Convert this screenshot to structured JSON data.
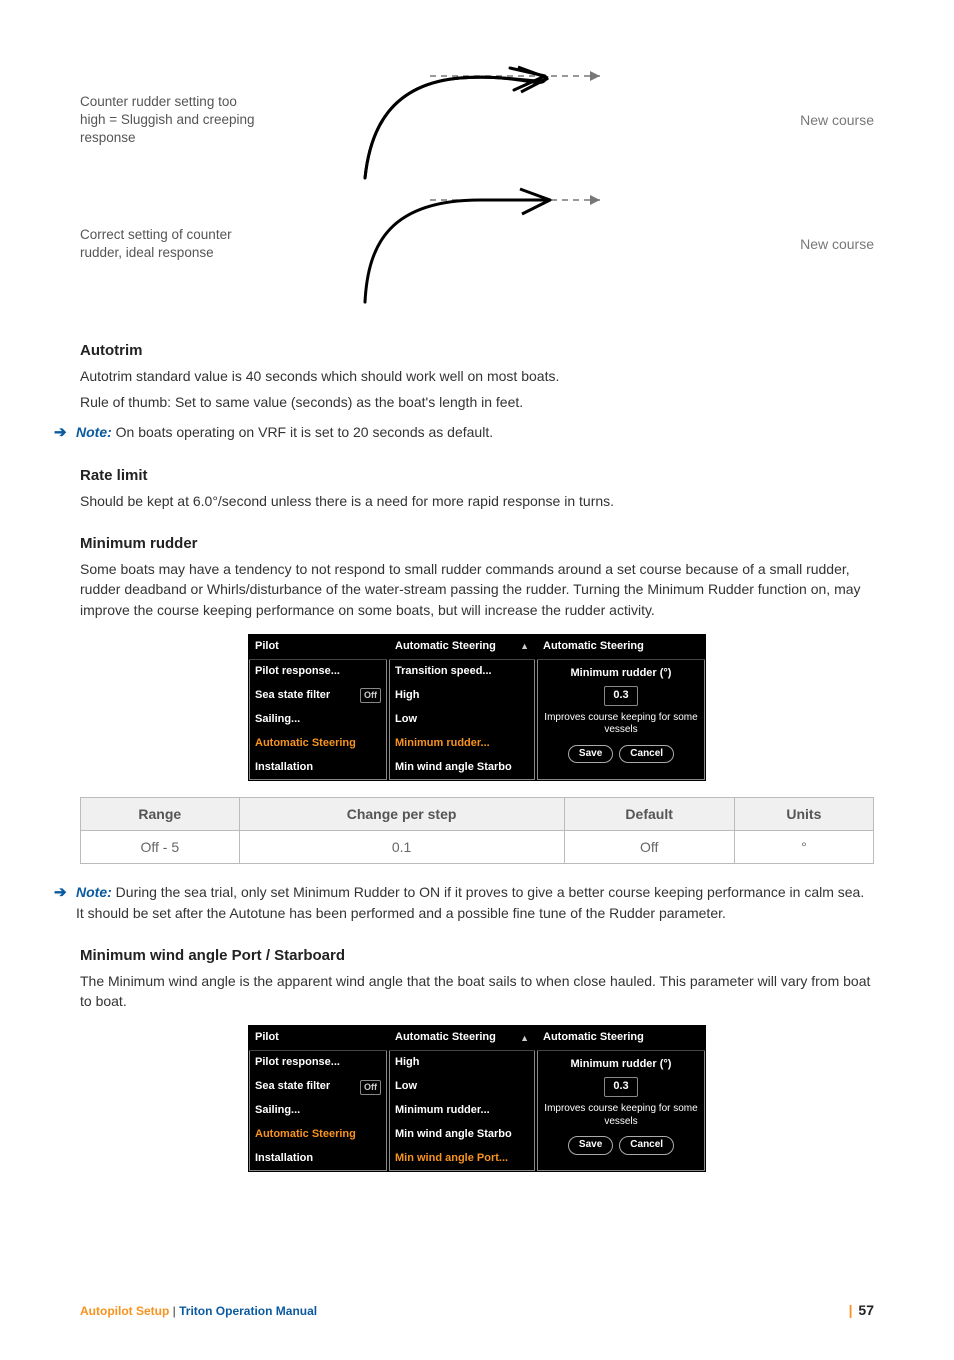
{
  "diagrams": [
    {
      "label": "Counter rudder setting too high = Sluggish and creeping response",
      "right": "New course"
    },
    {
      "label": "Correct setting of counter rudder, ideal response",
      "right": "New course"
    }
  ],
  "sections": {
    "autotrim": {
      "heading": "Autotrim",
      "p1": "Autotrim standard value is 40 seconds which should work well on most boats.",
      "p2": "Rule of thumb: Set to same value (seconds) as the boat's length in feet.",
      "note_label": "Note:",
      "note_text": " On boats operating on VRF it is set to 20 seconds as default."
    },
    "ratelimit": {
      "heading": "Rate limit",
      "p1": "Should be kept at 6.0°/second unless there is a need for more rapid response in turns."
    },
    "minrudder": {
      "heading": "Minimum rudder",
      "p1": "Some boats may have a tendency to not respond to small rudder commands around a set course because of a small rudder, rudder deadband or Whirls/disturbance of the water-stream passing the rudder. Turning the Minimum Rudder function on, may improve the course keeping performance on some boats, but will increase the rudder activity.",
      "note_label": "Note:",
      "note_text": " During the sea trial, only set Minimum Rudder to ON if it proves to give a better course keeping performance in calm sea. It should be set after the Autotune has been performed and a possible fine tune of the Rudder parameter."
    },
    "minwind": {
      "heading": "Minimum wind angle Port / Starboard",
      "p1": "The Minimum wind angle is the apparent wind angle that the boat sails to when close hauled. This parameter will vary from boat to boat."
    }
  },
  "screens1": {
    "menu": {
      "title": "Pilot",
      "items": [
        {
          "label": "Pilot response..."
        },
        {
          "label": "Sea state filter",
          "tag": "Off"
        },
        {
          "label": "Sailing..."
        },
        {
          "label": "Automatic Steering",
          "orange": true
        },
        {
          "label": "Installation"
        }
      ]
    },
    "sub": {
      "title": "Automatic Steering",
      "items": [
        {
          "label": "Transition speed..."
        },
        {
          "label": "High"
        },
        {
          "label": "Low"
        },
        {
          "label": "Minimum rudder...",
          "orange": true
        },
        {
          "label": "Min wind angle Starbo"
        }
      ]
    },
    "modal": {
      "title": "Automatic Steering",
      "line1": "Minimum rudder (°)",
      "value": "0.3",
      "line2": "Improves course keeping for some vessels",
      "save": "Save",
      "cancel": "Cancel"
    }
  },
  "table": {
    "headers": [
      "Range",
      "Change per step",
      "Default",
      "Units"
    ],
    "row": [
      "Off - 5",
      "0.1",
      "Off",
      "°"
    ]
  },
  "screens2": {
    "menu": {
      "title": "Pilot",
      "items": [
        {
          "label": "Pilot response..."
        },
        {
          "label": "Sea state filter",
          "tag": "Off"
        },
        {
          "label": "Sailing..."
        },
        {
          "label": "Automatic Steering",
          "orange": true
        },
        {
          "label": "Installation"
        }
      ]
    },
    "sub": {
      "title": "Automatic Steering",
      "items": [
        {
          "label": "High"
        },
        {
          "label": "Low"
        },
        {
          "label": "Minimum rudder..."
        },
        {
          "label": "Min wind angle Starbo"
        },
        {
          "label": "Min wind angle Port...",
          "orange": true
        }
      ]
    },
    "modal": {
      "title": "Automatic Steering",
      "line1": "Minimum rudder (°)",
      "value": "0.3",
      "line2": "Improves course keeping for some vessels",
      "save": "Save",
      "cancel": "Cancel"
    }
  },
  "footer": {
    "section": "Autopilot Setup",
    "sep": " | ",
    "manual": "Triton Operation Manual",
    "page_bar": "|",
    "page": " 57"
  }
}
